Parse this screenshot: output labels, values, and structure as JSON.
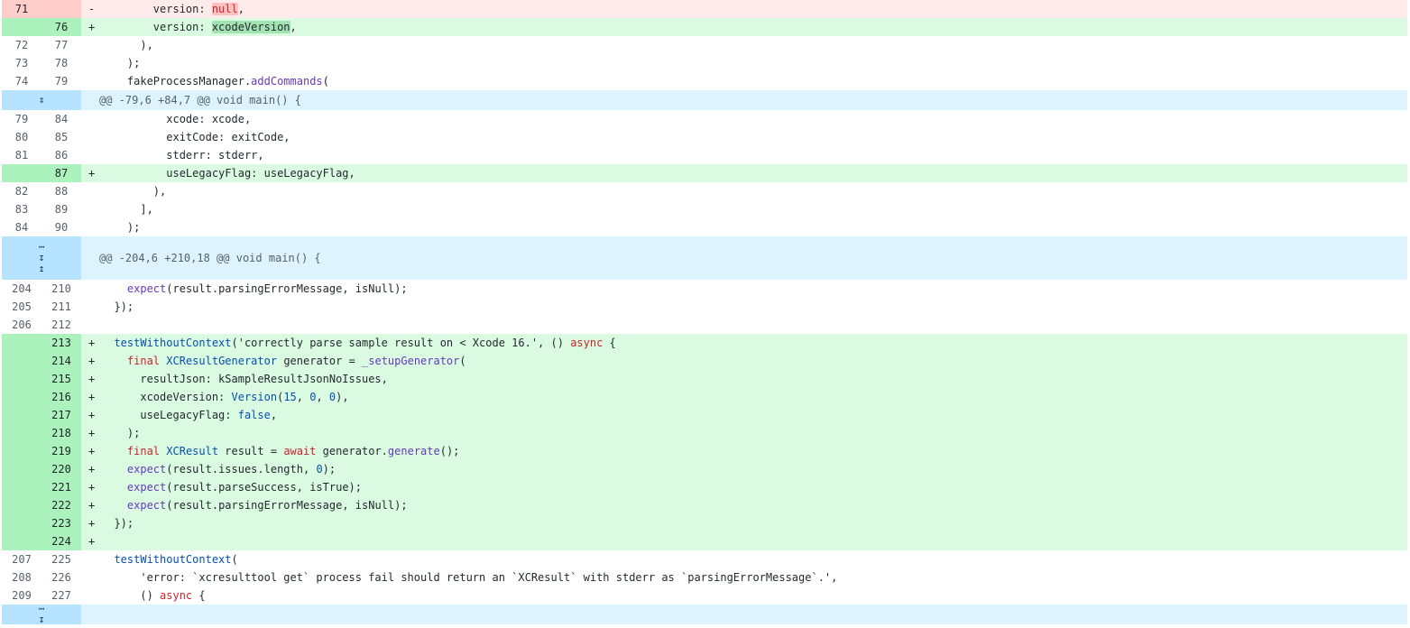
{
  "diff": {
    "rows": [
      {
        "type": "del",
        "old": "71",
        "new": "",
        "sign": "-",
        "tokens": [
          {
            "t": "        version: "
          },
          {
            "t": "null",
            "c": "hl-del t-kw"
          },
          {
            "t": ","
          }
        ]
      },
      {
        "type": "add",
        "old": "",
        "new": "76",
        "sign": "+",
        "tokens": [
          {
            "t": "        version: "
          },
          {
            "t": "xcodeVersion",
            "c": "hl-add"
          },
          {
            "t": ","
          }
        ]
      },
      {
        "type": "ctx",
        "old": "72",
        "new": "77",
        "sign": "",
        "tokens": [
          {
            "t": "      ),"
          }
        ]
      },
      {
        "type": "ctx",
        "old": "73",
        "new": "78",
        "sign": "",
        "tokens": [
          {
            "t": "    );"
          }
        ]
      },
      {
        "type": "ctx",
        "old": "74",
        "new": "79",
        "sign": "",
        "tokens": [
          {
            "t": "    fakeProcessManager."
          },
          {
            "t": "addCommands",
            "c": "t-fn"
          },
          {
            "t": "("
          }
        ]
      },
      {
        "type": "hunk",
        "size": "short",
        "icon": "expand-both",
        "header": "@@ -79,6 +84,7 @@ void main() {"
      },
      {
        "type": "ctx",
        "old": "79",
        "new": "84",
        "sign": "",
        "tokens": [
          {
            "t": "          xcode: xcode,"
          }
        ]
      },
      {
        "type": "ctx",
        "old": "80",
        "new": "85",
        "sign": "",
        "tokens": [
          {
            "t": "          exitCode: exitCode,"
          }
        ]
      },
      {
        "type": "ctx",
        "old": "81",
        "new": "86",
        "sign": "",
        "tokens": [
          {
            "t": "          stderr: stderr,"
          }
        ]
      },
      {
        "type": "add",
        "old": "",
        "new": "87",
        "sign": "+",
        "tokens": [
          {
            "t": "          useLegacyFlag: useLegacyFlag,"
          }
        ]
      },
      {
        "type": "ctx",
        "old": "82",
        "new": "88",
        "sign": "",
        "tokens": [
          {
            "t": "        ),"
          }
        ]
      },
      {
        "type": "ctx",
        "old": "83",
        "new": "89",
        "sign": "",
        "tokens": [
          {
            "t": "      ],"
          }
        ]
      },
      {
        "type": "ctx",
        "old": "84",
        "new": "90",
        "sign": "",
        "tokens": [
          {
            "t": "    );"
          }
        ]
      },
      {
        "type": "hunk",
        "size": "tall",
        "icon": "expand-split",
        "header": "@@ -204,6 +210,18 @@ void main() {"
      },
      {
        "type": "ctx",
        "old": "204",
        "new": "210",
        "sign": "",
        "tokens": [
          {
            "t": "    "
          },
          {
            "t": "expect",
            "c": "t-fn"
          },
          {
            "t": "(result.parsingErrorMessage, isNull);"
          }
        ]
      },
      {
        "type": "ctx",
        "old": "205",
        "new": "211",
        "sign": "",
        "tokens": [
          {
            "t": "  });"
          }
        ]
      },
      {
        "type": "ctx",
        "old": "206",
        "new": "212",
        "sign": "",
        "tokens": [
          {
            "t": ""
          }
        ]
      },
      {
        "type": "add",
        "old": "",
        "new": "213",
        "sign": "+",
        "tokens": [
          {
            "t": "  "
          },
          {
            "t": "testWithoutContext",
            "c": "t-ty"
          },
          {
            "t": "('correctly parse sample result on < Xcode 16.', () "
          },
          {
            "t": "async",
            "c": "t-kw"
          },
          {
            "t": " {"
          }
        ]
      },
      {
        "type": "add",
        "old": "",
        "new": "214",
        "sign": "+",
        "tokens": [
          {
            "t": "    "
          },
          {
            "t": "final",
            "c": "t-kw"
          },
          {
            "t": " "
          },
          {
            "t": "XCResultGenerator",
            "c": "t-ty"
          },
          {
            "t": " generator = "
          },
          {
            "t": "_setupGenerator",
            "c": "t-fn"
          },
          {
            "t": "("
          }
        ]
      },
      {
        "type": "add",
        "old": "",
        "new": "215",
        "sign": "+",
        "tokens": [
          {
            "t": "      resultJson: kSampleResultJsonNoIssues,"
          }
        ]
      },
      {
        "type": "add",
        "old": "",
        "new": "216",
        "sign": "+",
        "tokens": [
          {
            "t": "      xcodeVersion: "
          },
          {
            "t": "Version",
            "c": "t-ty"
          },
          {
            "t": "("
          },
          {
            "t": "15",
            "c": "t-lit"
          },
          {
            "t": ", "
          },
          {
            "t": "0",
            "c": "t-lit"
          },
          {
            "t": ", "
          },
          {
            "t": "0",
            "c": "t-lit"
          },
          {
            "t": "),"
          }
        ]
      },
      {
        "type": "add",
        "old": "",
        "new": "217",
        "sign": "+",
        "tokens": [
          {
            "t": "      useLegacyFlag: "
          },
          {
            "t": "false",
            "c": "t-lit"
          },
          {
            "t": ","
          }
        ]
      },
      {
        "type": "add",
        "old": "",
        "new": "218",
        "sign": "+",
        "tokens": [
          {
            "t": "    );"
          }
        ]
      },
      {
        "type": "add",
        "old": "",
        "new": "219",
        "sign": "+",
        "tokens": [
          {
            "t": "    "
          },
          {
            "t": "final",
            "c": "t-kw"
          },
          {
            "t": " "
          },
          {
            "t": "XCResult",
            "c": "t-ty"
          },
          {
            "t": " result = "
          },
          {
            "t": "await",
            "c": "t-kw"
          },
          {
            "t": " generator."
          },
          {
            "t": "generate",
            "c": "t-fn"
          },
          {
            "t": "();"
          }
        ]
      },
      {
        "type": "add",
        "old": "",
        "new": "220",
        "sign": "+",
        "tokens": [
          {
            "t": "    "
          },
          {
            "t": "expect",
            "c": "t-fn"
          },
          {
            "t": "(result.issues.length, "
          },
          {
            "t": "0",
            "c": "t-lit"
          },
          {
            "t": ");"
          }
        ]
      },
      {
        "type": "add",
        "old": "",
        "new": "221",
        "sign": "+",
        "tokens": [
          {
            "t": "    "
          },
          {
            "t": "expect",
            "c": "t-fn"
          },
          {
            "t": "(result.parseSuccess, isTrue);"
          }
        ]
      },
      {
        "type": "add",
        "old": "",
        "new": "222",
        "sign": "+",
        "tokens": [
          {
            "t": "    "
          },
          {
            "t": "expect",
            "c": "t-fn"
          },
          {
            "t": "(result.parsingErrorMessage, isNull);"
          }
        ]
      },
      {
        "type": "add",
        "old": "",
        "new": "223",
        "sign": "+",
        "tokens": [
          {
            "t": "  });"
          }
        ]
      },
      {
        "type": "add",
        "old": "",
        "new": "224",
        "sign": "+",
        "tokens": [
          {
            "t": ""
          }
        ]
      },
      {
        "type": "ctx",
        "old": "207",
        "new": "225",
        "sign": "",
        "tokens": [
          {
            "t": "  "
          },
          {
            "t": "testWithoutContext",
            "c": "t-ty"
          },
          {
            "t": "("
          }
        ]
      },
      {
        "type": "ctx",
        "old": "208",
        "new": "226",
        "sign": "",
        "tokens": [
          {
            "t": "      'error: `xcresulttool get` process fail should return an `XCResult` with stderr as `parsingErrorMessage`.',"
          }
        ]
      },
      {
        "type": "ctx",
        "old": "209",
        "new": "227",
        "sign": "",
        "tokens": [
          {
            "t": "      () "
          },
          {
            "t": "async",
            "c": "t-kw"
          },
          {
            "t": " {"
          }
        ]
      },
      {
        "type": "hunk",
        "size": "short",
        "icon": "expand-down",
        "header": ""
      }
    ]
  }
}
